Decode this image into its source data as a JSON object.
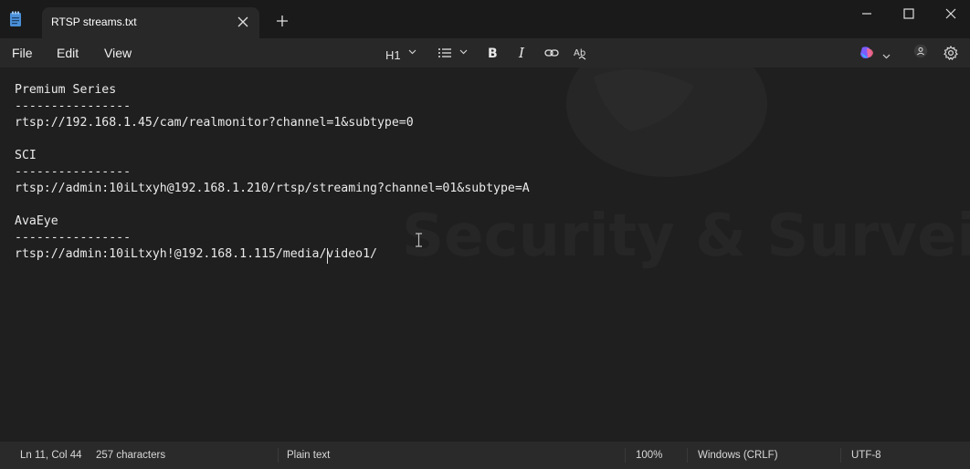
{
  "window": {
    "tab_title": "RTSP streams.txt"
  },
  "menu": {
    "items": [
      {
        "label": "File"
      },
      {
        "label": "Edit"
      },
      {
        "label": "View"
      }
    ]
  },
  "toolbar": {
    "heading_label": "H1",
    "icons": [
      "list-icon",
      "bold-icon",
      "italic-icon",
      "link-icon",
      "spellcheck-icon",
      "copilot-icon",
      "account-icon",
      "settings-icon"
    ]
  },
  "editor": {
    "lines": [
      "Premium Series",
      "----------------",
      "rtsp://192.168.1.45/cam/realmonitor?channel=1&subtype=0",
      "",
      "SCI",
      "----------------",
      "rtsp://admin:10iLtxyh@192.168.1.210/rtsp/streaming?channel=01&subtype=A",
      "",
      "AvaEye",
      "----------------",
      "rtsp://admin:10iLtxyh!@192.168.1.115/media/video1/"
    ],
    "watermark_text": "Security & Surveillance Syst"
  },
  "status": {
    "position": "Ln 11, Col 44",
    "characters": "257 characters",
    "format": "Plain text",
    "zoom": "100%",
    "line_ending": "Windows (CRLF)",
    "encoding": "UTF-8"
  },
  "colors": {
    "titlebar_bg": "#1a1a1a",
    "menubar_bg": "#282828",
    "editor_bg": "#1f1f1f",
    "statusbar_bg": "#2a2a2a",
    "app_icon": "#4a90d9"
  }
}
